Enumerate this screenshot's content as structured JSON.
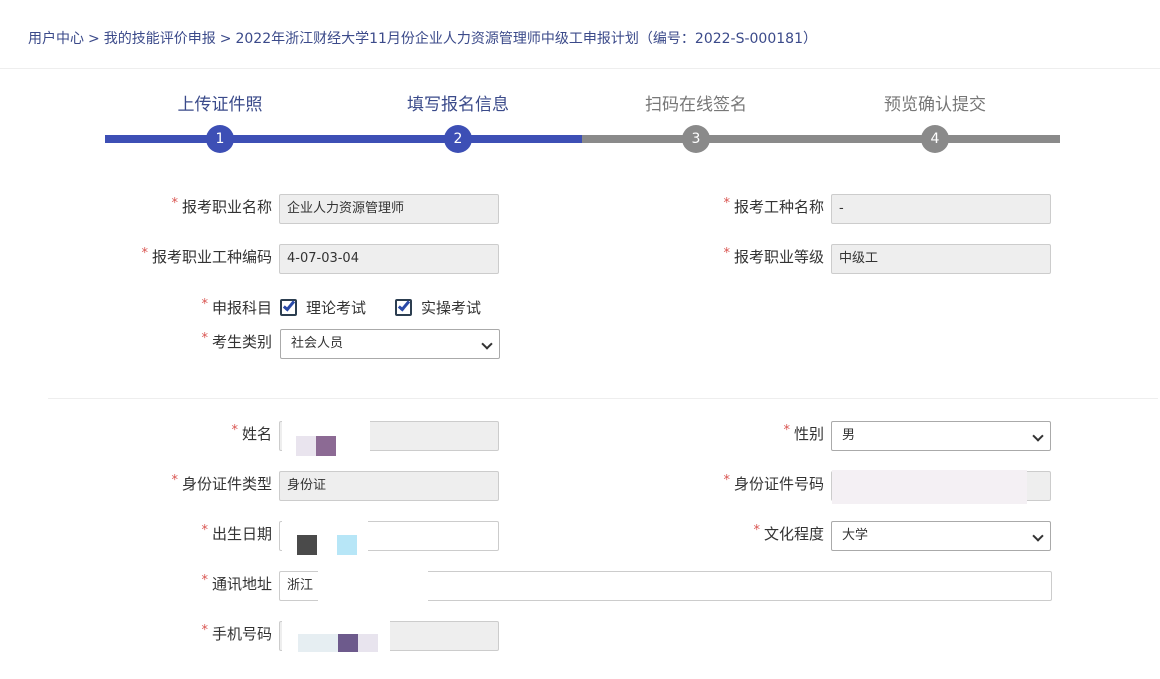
{
  "breadcrumb": {
    "items": [
      "用户中心",
      "我的技能评价申报",
      "2022年浙江财经大学11月份企业人力资源管理师中级工申报计划（编号：2022-S-000181）"
    ],
    "separator": ">"
  },
  "steps": [
    {
      "label": "上传证件照",
      "number": "1",
      "status": "done"
    },
    {
      "label": "填写报名信息",
      "number": "2",
      "status": "done"
    },
    {
      "label": "扫码在线签名",
      "number": "3",
      "status": "todo"
    },
    {
      "label": "预览确认提交",
      "number": "4",
      "status": "todo"
    }
  ],
  "required_mark": "*",
  "form": {
    "occupation_name": {
      "label": "报考职业名称",
      "value": "企业人力资源管理师"
    },
    "job_type_name": {
      "label": "报考工种名称",
      "value": "-"
    },
    "job_type_code": {
      "label": "报考职业工种编码",
      "value": "4-07-03-04"
    },
    "occupation_level": {
      "label": "报考职业等级",
      "value": "中级工"
    },
    "subjects": {
      "label": "申报科目",
      "options": [
        {
          "label": "理论考试",
          "checked": true
        },
        {
          "label": "实操考试",
          "checked": true
        }
      ]
    },
    "candidate_type": {
      "label": "考生类别",
      "value": "社会人员"
    },
    "name": {
      "label": "姓名",
      "value": ""
    },
    "gender": {
      "label": "性别",
      "value": "男"
    },
    "id_type": {
      "label": "身份证件类型",
      "value": "身份证"
    },
    "id_number": {
      "label": "身份证件号码",
      "value": ""
    },
    "birth_date": {
      "label": "出生日期",
      "value": ""
    },
    "education": {
      "label": "文化程度",
      "value": "大学"
    },
    "address": {
      "label": "通讯地址",
      "value": "浙江"
    },
    "phone": {
      "label": "手机号码",
      "value": ""
    }
  },
  "colors": {
    "accent": "#3d4fb5",
    "inactive": "#8a8a8a",
    "required": "#d9534f"
  }
}
